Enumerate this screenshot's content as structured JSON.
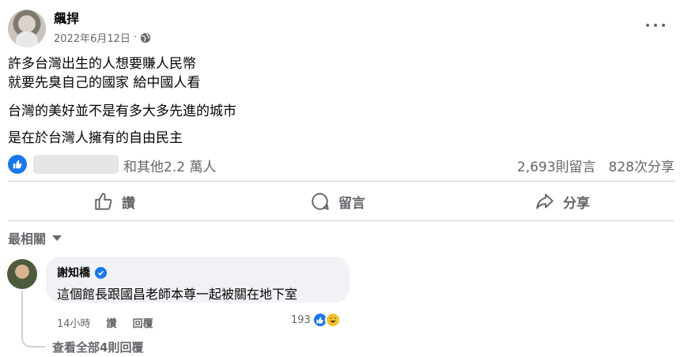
{
  "post": {
    "author": "飆捍",
    "date": "2022年6月12日",
    "audience_icon": "globe-icon",
    "lines": [
      "許多台灣出生的人想要賺人民幣",
      "就要先臭自己的國家 給中國人看",
      "台灣的美好並不是有多大多先進的城市",
      "是在於台灣人擁有的自由民主"
    ]
  },
  "stats": {
    "reactions_text": "和其他2.2 萬人",
    "comments": "2,693則留言",
    "shares": "828次分享"
  },
  "actions": {
    "like": "讚",
    "comment": "留言",
    "share": "分享"
  },
  "filter": {
    "label": "最相關"
  },
  "comment": {
    "author": "謝知橋",
    "text": "這個館長跟國昌老師本尊一起被關在地下室",
    "time": "14小時",
    "like": "讚",
    "reply": "回覆",
    "reaction_count": "193",
    "view_replies": "查看全部4則回覆"
  },
  "colors": {
    "brand_blue": "#1877f2",
    "muted_text": "#65676b",
    "bubble_bg": "#f0f2f5"
  }
}
